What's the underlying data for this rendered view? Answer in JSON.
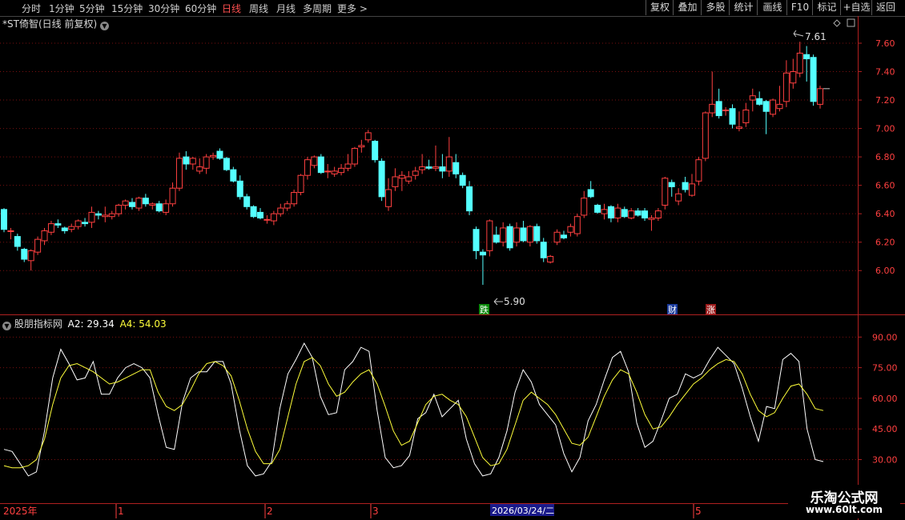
{
  "toolbar": {
    "periods": [
      "分时",
      "1分钟",
      "5分钟",
      "15分钟",
      "30分钟",
      "60分钟",
      "日线",
      "周线",
      "月线",
      "多周期",
      "更多 >"
    ],
    "active_period": "日线",
    "tools": [
      "复权",
      "叠加",
      "多股",
      "统计",
      "画线",
      "F10",
      "标记",
      "+自选",
      "返回"
    ]
  },
  "main_chart": {
    "title": "*ST倚智(日线 前复权)",
    "high_label": "7.61",
    "low_label": "5.90",
    "markers": {
      "die": "跌",
      "cai": "财",
      "zhang": "涨"
    },
    "colors": {
      "up": "#ff4040",
      "down": "#54ffff"
    }
  },
  "indicator": {
    "name": "股朋指标网",
    "a2_text": "A2: 29.34",
    "a4_text": "A4: 54.03",
    "colors": {
      "a2": "#ffffff",
      "a4": "#ffff3a"
    }
  },
  "date_axis": {
    "year_label": "2025年",
    "month_labels": [
      "1",
      "2",
      "3",
      "5"
    ],
    "cursor_date": "2026/03/24/二"
  },
  "watermark": {
    "line1": "乐淘公式网",
    "line2": "www.60lt.com"
  },
  "chart_data": [
    {
      "type": "candlestick",
      "y_ticks": [
        6.0,
        6.2,
        6.4,
        6.6,
        6.8,
        7.0,
        7.2,
        7.4,
        7.6
      ],
      "ylim": [
        5.81,
        7.69
      ],
      "grid": true,
      "series": [
        {
          "ohlc": [
            [
              6.43,
              6.44,
              6.27,
              6.29
            ],
            [
              6.28,
              6.3,
              6.22,
              6.28
            ],
            [
              6.24,
              6.26,
              6.14,
              6.17
            ],
            [
              6.15,
              6.16,
              6.06,
              6.08
            ],
            [
              6.07,
              6.15,
              6.0,
              6.14
            ],
            [
              6.13,
              6.24,
              6.11,
              6.22
            ],
            [
              6.21,
              6.3,
              6.18,
              6.28
            ],
            [
              6.27,
              6.35,
              6.25,
              6.33
            ],
            [
              6.33,
              6.36,
              6.3,
              6.32
            ],
            [
              6.3,
              6.31,
              6.26,
              6.28
            ],
            [
              6.29,
              6.33,
              6.27,
              6.31
            ],
            [
              6.31,
              6.36,
              6.29,
              6.35
            ],
            [
              6.34,
              6.37,
              6.31,
              6.33
            ],
            [
              6.34,
              6.45,
              6.3,
              6.41
            ],
            [
              6.4,
              6.42,
              6.36,
              6.39
            ],
            [
              6.38,
              6.45,
              6.34,
              6.39
            ],
            [
              6.38,
              6.42,
              6.36,
              6.4
            ],
            [
              6.4,
              6.47,
              6.38,
              6.46
            ],
            [
              6.46,
              6.5,
              6.43,
              6.49
            ],
            [
              6.48,
              6.51,
              6.43,
              6.45
            ],
            [
              6.44,
              6.52,
              6.42,
              6.51
            ],
            [
              6.51,
              6.54,
              6.45,
              6.47
            ],
            [
              6.46,
              6.48,
              6.43,
              6.47
            ],
            [
              6.47,
              6.49,
              6.41,
              6.42
            ],
            [
              6.41,
              6.5,
              6.39,
              6.47
            ],
            [
              6.47,
              6.62,
              6.45,
              6.58
            ],
            [
              6.58,
              6.83,
              6.56,
              6.79
            ],
            [
              6.8,
              6.84,
              6.71,
              6.75
            ],
            [
              6.75,
              6.8,
              6.71,
              6.79
            ],
            [
              6.7,
              6.79,
              6.68,
              6.73
            ],
            [
              6.72,
              6.82,
              6.68,
              6.8
            ],
            [
              6.8,
              6.83,
              6.78,
              6.81
            ],
            [
              6.84,
              6.86,
              6.78,
              6.79
            ],
            [
              6.79,
              6.8,
              6.7,
              6.71
            ],
            [
              6.71,
              6.73,
              6.62,
              6.63
            ],
            [
              6.63,
              6.67,
              6.5,
              6.52
            ],
            [
              6.52,
              6.54,
              6.43,
              6.45
            ],
            [
              6.45,
              6.46,
              6.37,
              6.38
            ],
            [
              6.41,
              6.44,
              6.36,
              6.37
            ],
            [
              6.36,
              6.39,
              6.33,
              6.36
            ],
            [
              6.35,
              6.42,
              6.32,
              6.4
            ],
            [
              6.4,
              6.47,
              6.38,
              6.44
            ],
            [
              6.44,
              6.49,
              6.42,
              6.47
            ],
            [
              6.47,
              6.57,
              6.45,
              6.55
            ],
            [
              6.55,
              6.68,
              6.53,
              6.67
            ],
            [
              6.67,
              6.8,
              6.64,
              6.78
            ],
            [
              6.74,
              6.81,
              6.72,
              6.8
            ],
            [
              6.8,
              6.82,
              6.68,
              6.69
            ],
            [
              6.7,
              6.75,
              6.65,
              6.7
            ],
            [
              6.68,
              6.73,
              6.66,
              6.7
            ],
            [
              6.69,
              6.75,
              6.67,
              6.72
            ],
            [
              6.72,
              6.82,
              6.7,
              6.75
            ],
            [
              6.75,
              6.87,
              6.73,
              6.86
            ],
            [
              6.87,
              6.92,
              6.83,
              6.88
            ],
            [
              6.92,
              6.99,
              6.9,
              6.97
            ],
            [
              6.91,
              6.92,
              6.76,
              6.78
            ],
            [
              6.77,
              6.79,
              6.49,
              6.52
            ],
            [
              6.45,
              6.65,
              6.42,
              6.57
            ],
            [
              6.59,
              6.72,
              6.56,
              6.66
            ],
            [
              6.65,
              6.7,
              6.56,
              6.67
            ],
            [
              6.63,
              6.7,
              6.61,
              6.66
            ],
            [
              6.67,
              6.73,
              6.64,
              6.7
            ],
            [
              6.71,
              6.82,
              6.68,
              6.73
            ],
            [
              6.73,
              6.78,
              6.71,
              6.72
            ],
            [
              6.72,
              6.88,
              6.7,
              6.73
            ],
            [
              6.73,
              6.82,
              6.65,
              6.7
            ],
            [
              6.7,
              6.94,
              6.66,
              6.8
            ],
            [
              6.76,
              6.82,
              6.65,
              6.68
            ],
            [
              6.67,
              6.69,
              6.58,
              6.6
            ],
            [
              6.59,
              6.63,
              6.39,
              6.42
            ],
            [
              6.29,
              6.31,
              6.08,
              6.14
            ],
            [
              6.13,
              6.15,
              5.9,
              6.11
            ],
            [
              6.14,
              6.36,
              6.1,
              6.35
            ],
            [
              6.25,
              6.31,
              6.19,
              6.2
            ],
            [
              6.2,
              6.34,
              6.17,
              6.3
            ],
            [
              6.31,
              6.33,
              6.14,
              6.16
            ],
            [
              6.2,
              6.34,
              6.17,
              6.3
            ],
            [
              6.3,
              6.35,
              6.2,
              6.21
            ],
            [
              6.2,
              6.32,
              6.17,
              6.31
            ],
            [
              6.31,
              6.33,
              6.19,
              6.21
            ],
            [
              6.2,
              6.23,
              6.06,
              6.09
            ],
            [
              6.06,
              6.11,
              6.05,
              6.1
            ],
            [
              6.2,
              6.29,
              6.18,
              6.27
            ],
            [
              6.25,
              6.28,
              6.22,
              6.23
            ],
            [
              6.27,
              6.33,
              6.24,
              6.31
            ],
            [
              6.26,
              6.4,
              6.24,
              6.38
            ],
            [
              6.39,
              6.56,
              6.37,
              6.51
            ],
            [
              6.57,
              6.63,
              6.51,
              6.52
            ],
            [
              6.46,
              6.47,
              6.4,
              6.41
            ],
            [
              6.4,
              6.47,
              6.36,
              6.43
            ],
            [
              6.45,
              6.46,
              6.34,
              6.37
            ],
            [
              6.37,
              6.47,
              6.34,
              6.44
            ],
            [
              6.43,
              6.45,
              6.37,
              6.38
            ],
            [
              6.37,
              6.44,
              6.36,
              6.42
            ],
            [
              6.42,
              6.44,
              6.38,
              6.39
            ],
            [
              6.42,
              6.44,
              6.35,
              6.37
            ],
            [
              6.36,
              6.39,
              6.28,
              6.37
            ],
            [
              6.37,
              6.44,
              6.35,
              6.42
            ],
            [
              6.46,
              6.66,
              6.43,
              6.65
            ],
            [
              6.62,
              6.64,
              6.52,
              6.59
            ],
            [
              6.49,
              6.58,
              6.46,
              6.54
            ],
            [
              6.62,
              6.66,
              6.55,
              6.57
            ],
            [
              6.53,
              6.68,
              6.52,
              6.61
            ],
            [
              6.63,
              6.8,
              6.6,
              6.78
            ],
            [
              6.79,
              7.12,
              6.77,
              7.11
            ],
            [
              7.11,
              7.4,
              7.08,
              7.17
            ],
            [
              7.19,
              7.28,
              7.07,
              7.09
            ],
            [
              7.13,
              7.15,
              7.09,
              7.13
            ],
            [
              7.14,
              7.17,
              7.0,
              7.03
            ],
            [
              7.0,
              7.12,
              6.98,
              7.01
            ],
            [
              7.04,
              7.18,
              7.01,
              7.13
            ],
            [
              7.2,
              7.28,
              7.12,
              7.23
            ],
            [
              7.21,
              7.26,
              7.16,
              7.17
            ],
            [
              7.19,
              7.2,
              6.96,
              7.12
            ],
            [
              7.1,
              7.21,
              7.08,
              7.2
            ],
            [
              7.14,
              7.3,
              7.12,
              7.17
            ],
            [
              7.19,
              7.48,
              7.15,
              7.39
            ],
            [
              7.32,
              7.49,
              7.28,
              7.4
            ],
            [
              7.39,
              7.61,
              7.36,
              7.53
            ],
            [
              7.52,
              7.58,
              7.33,
              7.49
            ],
            [
              7.5,
              7.52,
              7.16,
              7.19
            ],
            [
              7.17,
              7.3,
              7.14,
              7.28
            ]
          ]
        }
      ]
    },
    {
      "type": "line",
      "y_ticks": [
        30.0,
        45.0,
        60.0,
        75.0,
        90.0
      ],
      "ylim": [
        20,
        96
      ],
      "grid": true,
      "series": [
        {
          "name": "A2",
          "values": [
            35,
            34,
            28,
            22,
            24,
            44,
            70,
            84,
            77,
            69,
            70,
            78,
            62,
            62,
            70,
            75,
            77,
            75,
            70,
            52,
            36,
            35,
            58,
            70,
            73,
            73,
            78,
            78,
            67,
            45,
            27,
            22,
            23,
            29,
            55,
            72,
            79,
            87,
            80,
            61,
            52,
            53,
            74,
            78,
            85,
            83,
            54,
            31,
            26,
            27,
            32,
            50,
            53,
            62,
            51,
            55,
            59,
            40,
            28,
            22,
            23,
            31,
            44,
            63,
            74,
            68,
            57,
            52,
            47,
            33,
            24,
            31,
            49,
            57,
            69,
            80,
            83,
            73,
            48,
            36,
            39,
            49,
            60,
            62,
            72,
            70,
            72,
            79,
            85,
            81,
            77,
            65,
            51,
            39,
            56,
            55,
            79,
            82,
            78,
            45,
            30,
            29
          ]
        },
        {
          "name": "A4",
          "values": [
            27,
            26,
            26,
            27,
            30,
            40,
            57,
            70,
            76,
            77,
            75,
            73,
            70,
            67,
            68,
            70,
            72,
            74,
            74,
            63,
            56,
            54,
            57,
            64,
            72,
            77,
            78,
            76,
            71,
            59,
            45,
            34,
            28,
            28,
            35,
            51,
            67,
            78,
            80,
            76,
            67,
            61,
            63,
            68,
            72,
            74,
            67,
            56,
            44,
            37,
            39,
            48,
            57,
            61,
            62,
            59,
            57,
            51,
            41,
            31,
            27,
            28,
            35,
            47,
            59,
            63,
            60,
            57,
            52,
            45,
            38,
            37,
            41,
            51,
            61,
            69,
            74,
            72,
            63,
            52,
            45,
            46,
            51,
            57,
            62,
            67,
            70,
            74,
            77,
            79,
            78,
            72,
            62,
            54,
            51,
            53,
            60,
            66,
            67,
            62,
            55,
            54
          ]
        }
      ]
    }
  ]
}
